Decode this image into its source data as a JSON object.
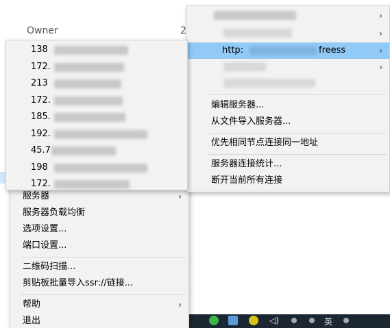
{
  "background": {
    "owner_label": "Owner",
    "number_text": "2"
  },
  "main_menu": {
    "items": [
      {
        "label": "服务器",
        "arrow": "›"
      },
      {
        "label": "服务器负载均衡",
        "arrow": ""
      },
      {
        "label": "选项设置...",
        "arrow": ""
      },
      {
        "label": "端口设置...",
        "arrow": ""
      },
      {
        "label": "二维码扫描...",
        "arrow": ""
      },
      {
        "label": "剪贴板批量导入ssr://链接...",
        "arrow": ""
      },
      {
        "label": "帮助",
        "arrow": "›"
      },
      {
        "label": "退出",
        "arrow": ""
      }
    ]
  },
  "server_menu": {
    "highlighted_item": {
      "prefix": "http:",
      "suffix": "freess",
      "arrow": "›"
    },
    "arrows": [
      "›",
      "›",
      "›"
    ],
    "actions": [
      "编辑服务器...",
      "从文件导入服务器...",
      "优先相同节点连接同一地址",
      "服务器连接统计...",
      "断开当前所有连接"
    ]
  },
  "ip_menu": {
    "items": [
      "138",
      "172.",
      "213",
      "172.",
      "185.",
      "192.",
      "45.7",
      "198",
      "172."
    ]
  },
  "taskbar": {
    "tray_text": "英"
  },
  "colors": {
    "menu_bg": "#f2f2f2",
    "highlight": "#91c9f7",
    "taskbar": "#1c2733"
  }
}
